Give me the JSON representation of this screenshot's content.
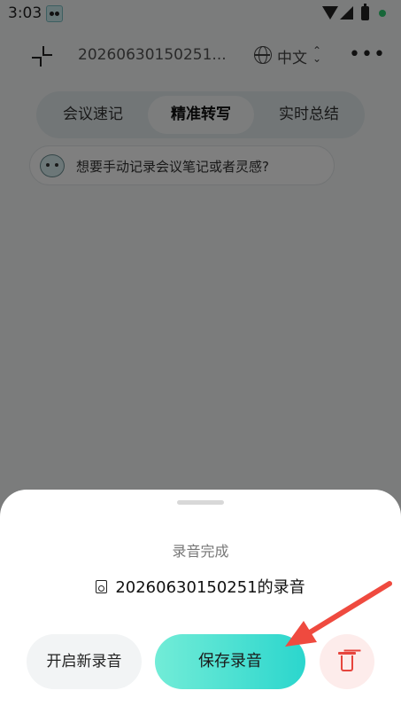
{
  "status_bar": {
    "time": "3:03"
  },
  "header": {
    "file_title": "20260630150251...",
    "language": "中文"
  },
  "mode_tabs": [
    {
      "label": "会议速记"
    },
    {
      "label": "精准转写"
    },
    {
      "label": "实时总结"
    }
  ],
  "hint": {
    "text": "想要手动记录会议笔记或者灵感?"
  },
  "sheet": {
    "status": "录音完成",
    "recording_name": "20260630150251的录音",
    "new_button": "开启新录音",
    "save_button": "保存录音"
  },
  "colors": {
    "accent_start": "#72ecd7",
    "accent_end": "#2bd6cd",
    "delete_bg": "#fdeceb",
    "delete_icon": "#e6453d",
    "annotation_arrow": "#ef4a3f"
  }
}
